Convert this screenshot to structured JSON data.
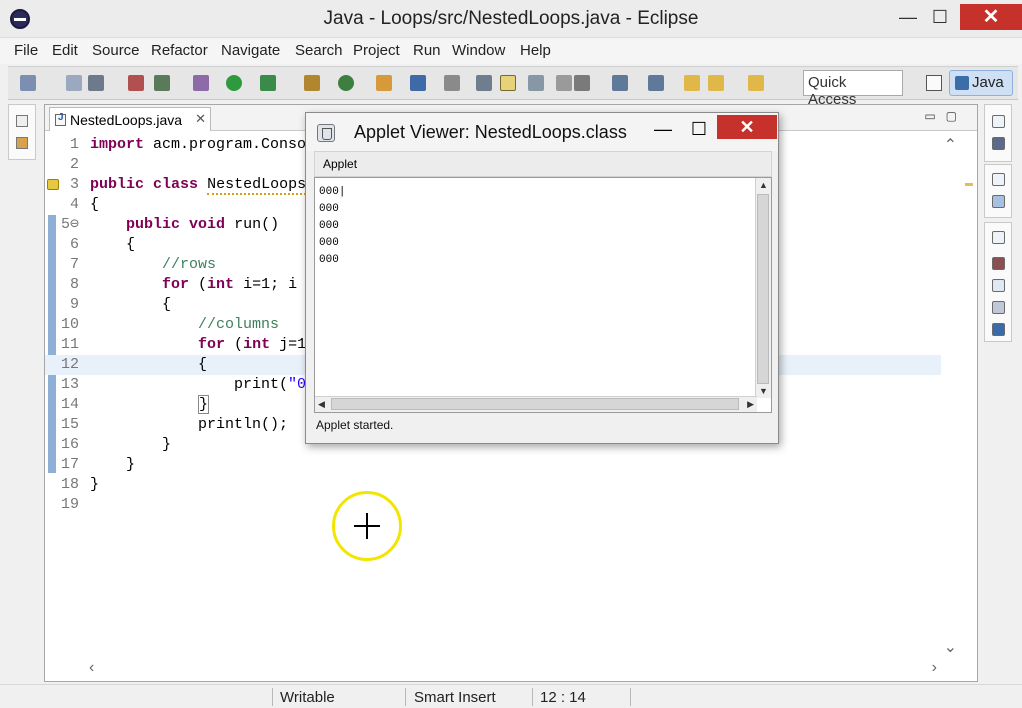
{
  "window": {
    "title": "Java - Loops/src/NestedLoops.java - Eclipse",
    "min_glyph": "—",
    "max_glyph": "☐",
    "close_glyph": "✕"
  },
  "menu": [
    "File",
    "Edit",
    "Source",
    "Refactor",
    "Navigate",
    "Search",
    "Project",
    "Run",
    "Window",
    "Help"
  ],
  "toolbar": {
    "quick_access_placeholder": "Quick Access",
    "perspective_label": "Java"
  },
  "editor": {
    "tab_label": "NestedLoops.java",
    "tab_close": "✕",
    "line_numbers": [
      "1",
      "2",
      "3",
      "4",
      "5⊖",
      "6",
      "7",
      "8",
      "9",
      "10",
      "11",
      "12",
      "13",
      "14",
      "15",
      "16",
      "17",
      "18",
      "19"
    ],
    "lines": [
      "import acm.program.Conso",
      "",
      "public class NestedLoops",
      "{",
      "    public void run()",
      "    {",
      "        //rows",
      "        for (int i=1; i",
      "        {",
      "            //columns",
      "            for (int j=1",
      "            {",
      "                print(\"0",
      "            }",
      "            println();",
      "        }",
      "    }",
      "}",
      ""
    ]
  },
  "applet_viewer": {
    "title": "Applet Viewer: NestedLoops.class",
    "menu_label": "Applet",
    "output_lines": [
      "000",
      "000",
      "000",
      "000",
      "000"
    ],
    "status": "Applet started.",
    "close_glyph": "✕",
    "min_glyph": "—",
    "max_glyph": "☐"
  },
  "status_bar": {
    "mode": "Writable",
    "insert_mode": "Smart Insert",
    "position": "12 : 14"
  },
  "colors": {
    "keyword": "#7f0055",
    "comment": "#3f7f5f",
    "string": "#2a00ff",
    "close_button": "#c7312b",
    "cursor_ring": "#f2e600"
  }
}
